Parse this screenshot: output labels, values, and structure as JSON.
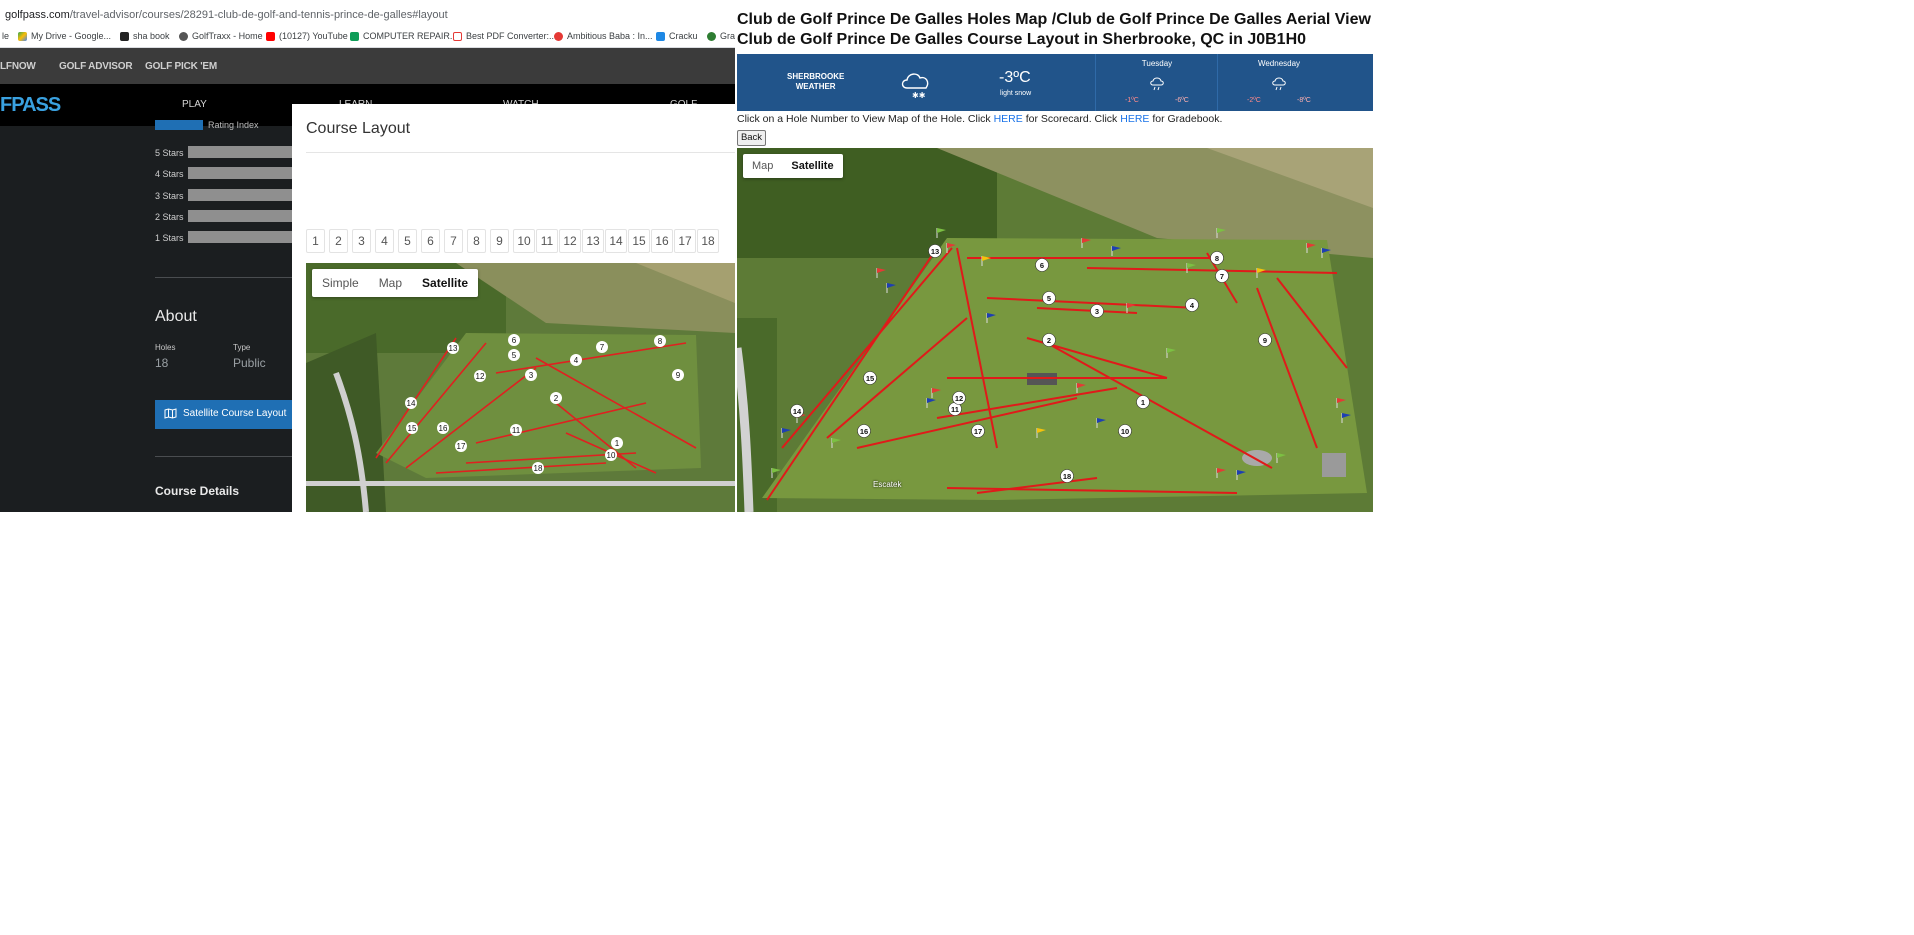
{
  "browser": {
    "url_host": "golfpass.com",
    "url_path": "/travel-advisor/courses/28291-club-de-golf-and-tennis-prince-de-galles#layout",
    "bookmarks": [
      "le",
      "My Drive - Google...",
      "sha book",
      "GolfTraxx - Home",
      "(10127) YouTube",
      "COMPUTER REPAIR...",
      "Best PDF Converter:...",
      "Ambitious Baba : In...",
      "Cracku",
      "Gra"
    ]
  },
  "site": {
    "top_nav": [
      "LFNOW",
      "GOLF ADVISOR",
      "GOLF PICK 'EM"
    ],
    "logo": "FPASS",
    "main_nav": [
      "PLAY",
      "LEARN",
      "WATCH",
      "GOLF ADVISOR"
    ],
    "rating_index": "Rating Index",
    "star_rows": [
      "5 Stars",
      "4 Stars",
      "3 Stars",
      "2 Stars",
      "1 Stars"
    ],
    "about_title": "About",
    "holes_label": "Holes",
    "holes_value": "18",
    "type_label": "Type",
    "type_value": "Public",
    "satellite_button": "Satellite Course Layout",
    "course_details": "Course Details"
  },
  "modal": {
    "title": "Course Layout",
    "hole_numbers": [
      "1",
      "2",
      "3",
      "4",
      "5",
      "6",
      "7",
      "8",
      "9",
      "10",
      "11",
      "12",
      "13",
      "14",
      "15",
      "16",
      "17",
      "18"
    ],
    "map_modes": [
      "Simple",
      "Map",
      "Satellite"
    ],
    "active_mode": "Satellite"
  },
  "right_page": {
    "title_line1": "Club de Golf Prince De Galles Holes Map /Club de Golf Prince De Galles Aerial View",
    "title_line2": "Club de Golf Prince De Galles Course Layout in Sherbrooke, QC in J0B1H0",
    "weather": {
      "city": "SHERBROOKE",
      "label": "WEATHER",
      "temp": "-3ºC",
      "condition": "light snow",
      "days": [
        {
          "name": "Tuesday",
          "hi": "-1ºC",
          "lo": "-6ºC"
        },
        {
          "name": "Wednesday",
          "hi": "-2ºC",
          "lo": "-8ºC"
        }
      ]
    },
    "instructions": {
      "part1": "Click on a Hole Number to View Map of the Hole. Click ",
      "link1": "HERE",
      "part2": " for Scorecard. Click ",
      "link2": "HERE",
      "part3": " for Gradebook."
    },
    "back_button": "Back",
    "map_modes": [
      "Map",
      "Satellite"
    ],
    "active_mode": "Satellite",
    "map_label": "Escatek",
    "hole_markers": [
      "1",
      "2",
      "3",
      "4",
      "5",
      "6",
      "7",
      "8",
      "9",
      "10",
      "11",
      "12",
      "13",
      "14",
      "15",
      "16",
      "17",
      "18"
    ]
  }
}
